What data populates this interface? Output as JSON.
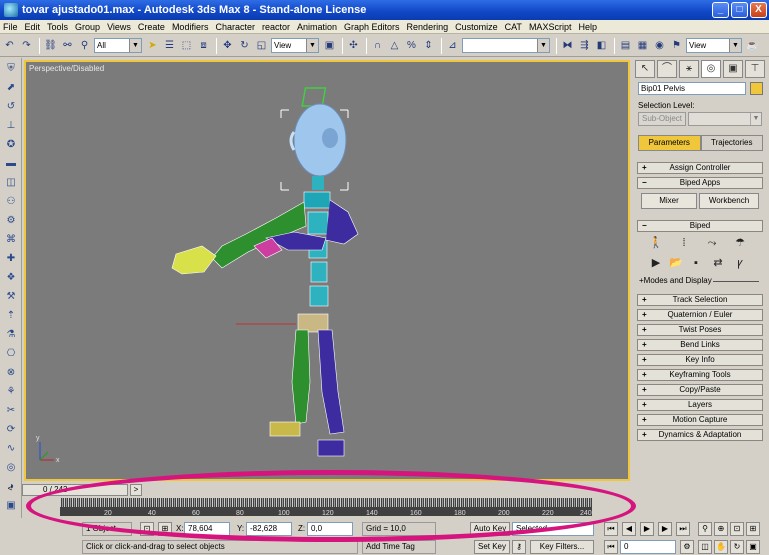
{
  "window": {
    "title": "tovar ajustado01.max - Autodesk 3ds Max 8 - Stand-alone License",
    "min": "_",
    "max": "□",
    "close": "X"
  },
  "menu": [
    "File",
    "Edit",
    "Tools",
    "Group",
    "Views",
    "Create",
    "Modifiers",
    "Character",
    "reactor",
    "Animation",
    "Graph Editors",
    "Rendering",
    "Customize",
    "CAT",
    "MAXScript",
    "Help"
  ],
  "toolbar": {
    "filter_value": "All",
    "refcoord_value": "View",
    "viewcombo_value": "View"
  },
  "viewport": {
    "label": "Perspective/Disabled",
    "axis_x": "x",
    "axis_y": "y"
  },
  "panel": {
    "object_name": "Bip01 Pelvis",
    "selection_level": "Selection Level:",
    "sub_object": "Sub-Object",
    "tab_parameters": "Parameters",
    "tab_trajectories": "Trajectories",
    "rollouts_top": [
      {
        "sign": "+",
        "label": "Assign Controller"
      },
      {
        "sign": "−",
        "label": "Biped Apps"
      }
    ],
    "mixer": "Mixer",
    "workbench": "Workbench",
    "biped_rollout": {
      "sign": "−",
      "label": "Biped"
    },
    "modes": "+Modes and Display",
    "rollouts_bottom": [
      {
        "sign": "+",
        "label": "Track Selection"
      },
      {
        "sign": "+",
        "label": "Quaternion / Euler"
      },
      {
        "sign": "+",
        "label": "Twist Poses"
      },
      {
        "sign": "+",
        "label": "Bend Links"
      },
      {
        "sign": "+",
        "label": "Key Info"
      },
      {
        "sign": "+",
        "label": "Keyframing Tools"
      },
      {
        "sign": "+",
        "label": "Copy/Paste"
      },
      {
        "sign": "+",
        "label": "Layers"
      },
      {
        "sign": "+",
        "label": "Motion Capture"
      },
      {
        "sign": "+",
        "label": "Dynamics & Adaptation"
      }
    ]
  },
  "timeline": {
    "slider": "0 / 243",
    "ticks": [
      "20",
      "40",
      "60",
      "80",
      "100",
      "120",
      "140",
      "160",
      "180",
      "200",
      "220",
      "240"
    ]
  },
  "status": {
    "selected": "1 Object",
    "x_label": "X:",
    "x_value": "78,604",
    "y_label": "Y:",
    "y_value": "-82,628",
    "z_label": "Z:",
    "z_value": "0,0",
    "grid": "Grid = 10,0",
    "prompt": "Click or click-and-drag to select objects",
    "add_time_tag": "Add Time Tag",
    "auto_key": "Auto Key",
    "auto_key_value": "Selected",
    "set_key": "Set Key",
    "key_filters": "Key Filters...",
    "frame": "0"
  },
  "colors": {
    "accent": "#f0c73a",
    "highlight": "#d6147e"
  }
}
